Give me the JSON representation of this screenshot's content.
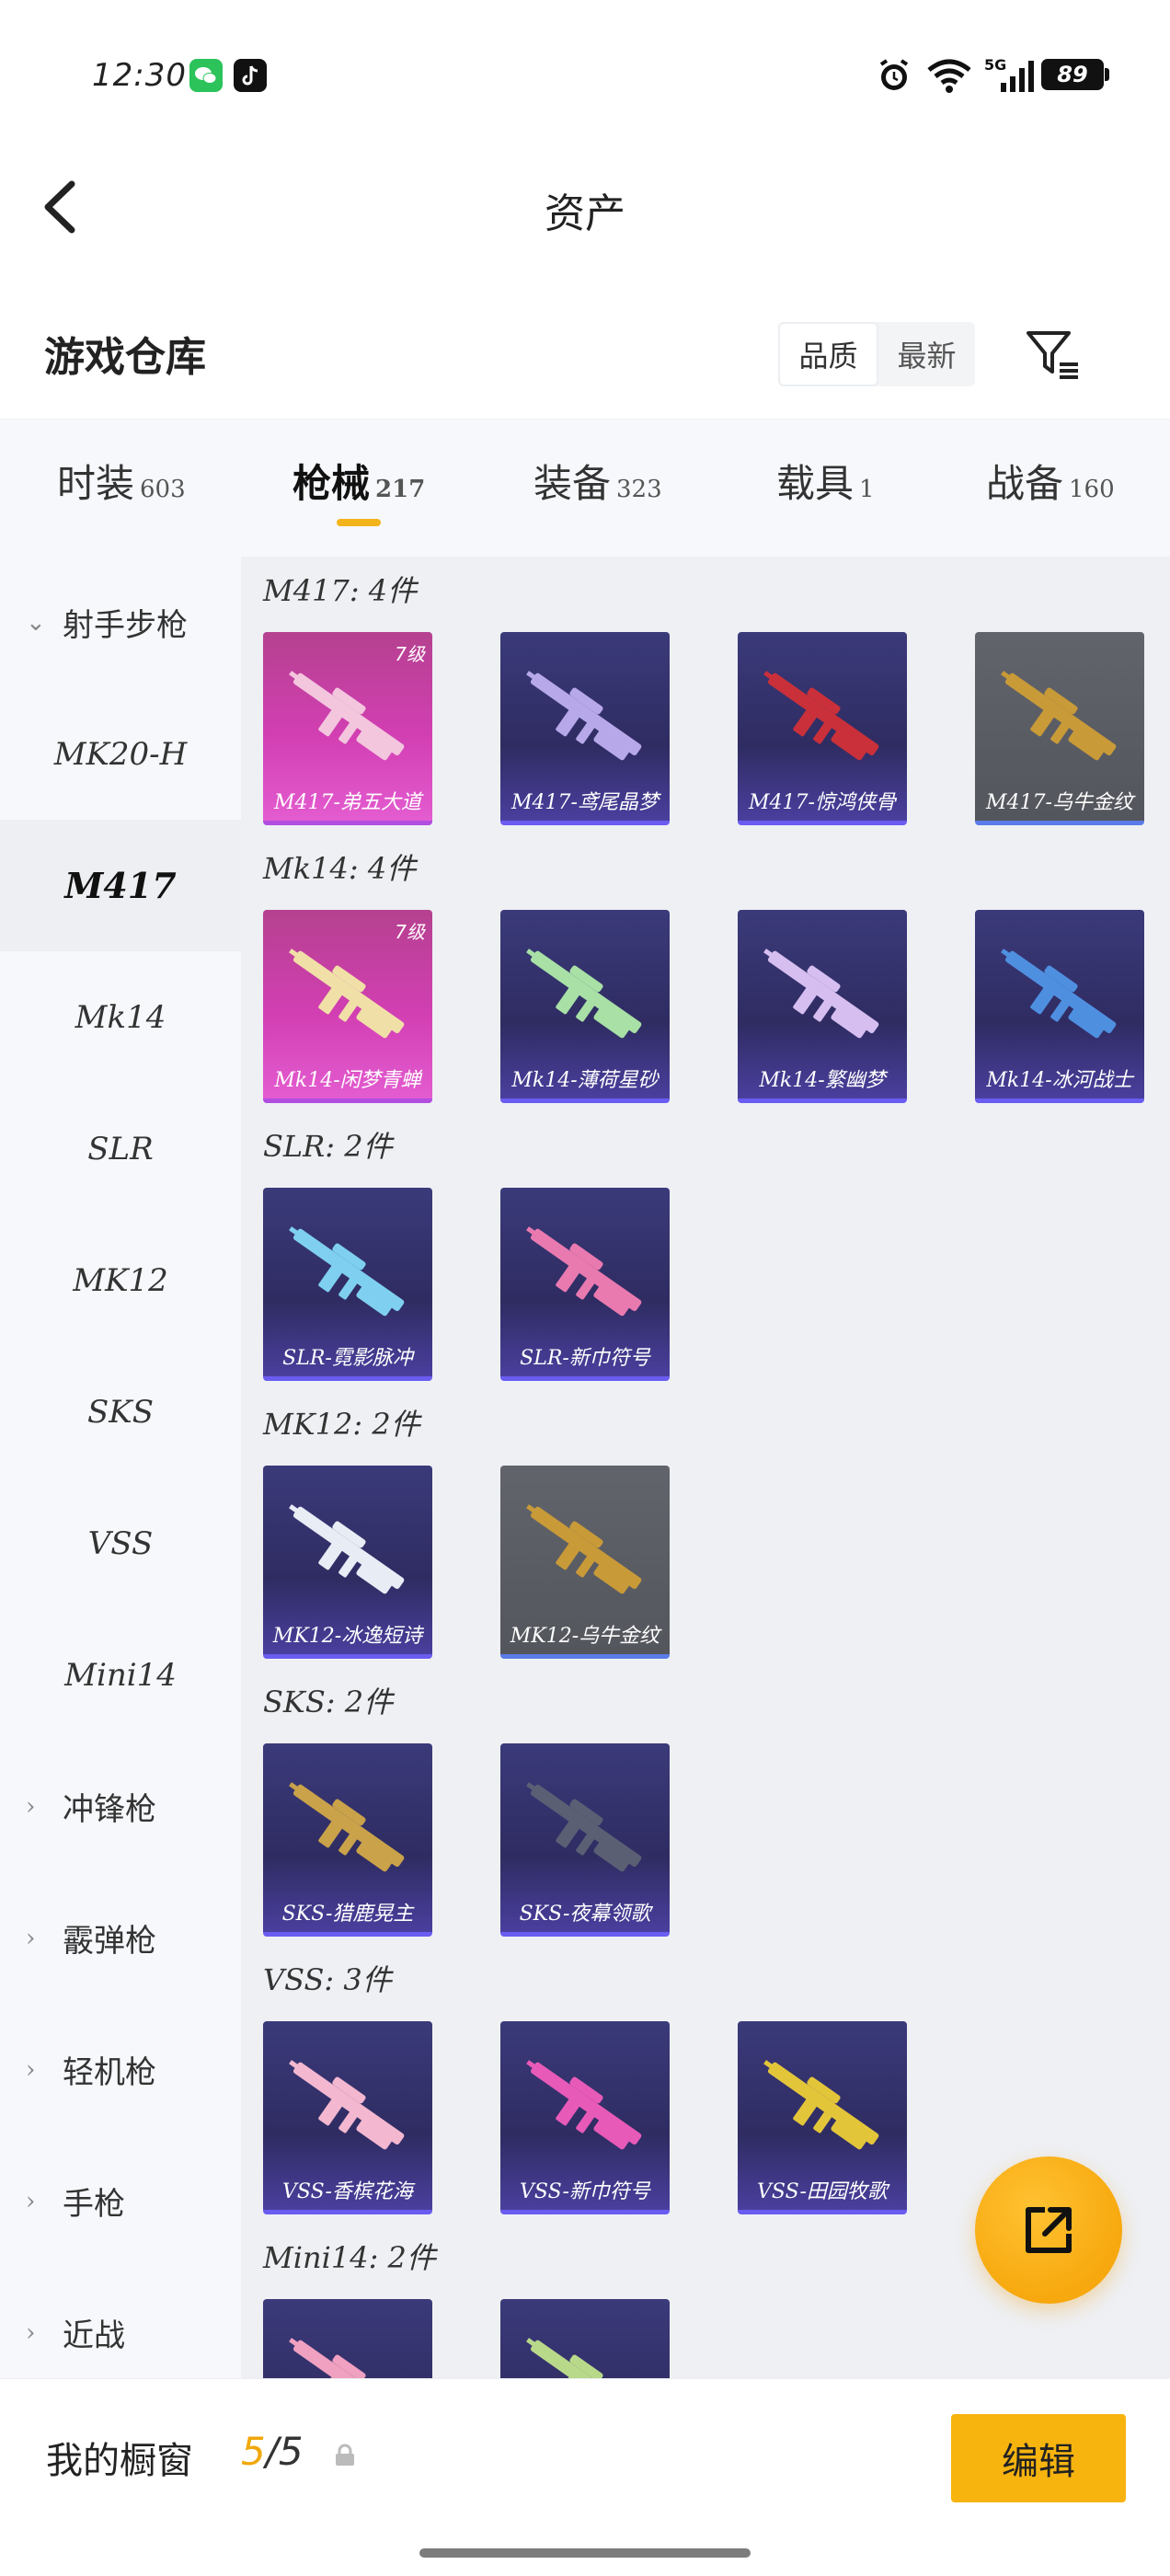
{
  "status_bar": {
    "time": "12:30",
    "battery": "89"
  },
  "header": {
    "title": "资产"
  },
  "warehouse": {
    "title": "游戏仓库",
    "sort_options": [
      "品质",
      "最新"
    ]
  },
  "tabs": [
    {
      "label": "时装",
      "count": "603"
    },
    {
      "label": "枪械",
      "count": "217"
    },
    {
      "label": "装备",
      "count": "323"
    },
    {
      "label": "载具",
      "count": "1"
    },
    {
      "label": "战备",
      "count": "160"
    }
  ],
  "sidebar": {
    "items": [
      {
        "label": "射手步枪",
        "type": "group-open"
      },
      {
        "label": "MK20-H"
      },
      {
        "label": "M417",
        "selected": true
      },
      {
        "label": "Mk14"
      },
      {
        "label": "SLR"
      },
      {
        "label": "MK12"
      },
      {
        "label": "SKS"
      },
      {
        "label": "VSS"
      },
      {
        "label": "Mini14"
      },
      {
        "label": "冲锋枪",
        "type": "group"
      },
      {
        "label": "霰弹枪",
        "type": "group"
      },
      {
        "label": "轻机枪",
        "type": "group"
      },
      {
        "label": "手枪",
        "type": "group"
      },
      {
        "label": "近战",
        "type": "group"
      }
    ]
  },
  "sections": [
    {
      "label": "M417: 4件",
      "items": [
        {
          "name": "M417-弟五大道",
          "level": "7级",
          "style": "pink",
          "gun": "#f3c6de"
        },
        {
          "name": "M417-鸢尾晶梦",
          "style": "purple",
          "gun": "#b7a8ea"
        },
        {
          "name": "M417-惊鸿侠骨",
          "style": "purple",
          "gun": "#c9303a"
        },
        {
          "name": "M417-乌牛金纹",
          "style": "gray",
          "gun": "#c89a38"
        }
      ]
    },
    {
      "label": "Mk14: 4件",
      "items": [
        {
          "name": "Mk14-闲梦青蝉",
          "level": "7级",
          "style": "pink",
          "gun": "#f1dfa8"
        },
        {
          "name": "Mk14-薄荷星砂",
          "style": "purple",
          "gun": "#a8e0a6"
        },
        {
          "name": "Mk14-繁幽梦",
          "style": "purple",
          "gun": "#d6bff0"
        },
        {
          "name": "Mk14-冰河战士",
          "style": "purple",
          "gun": "#4f8fe0"
        }
      ]
    },
    {
      "label": "SLR: 2件",
      "items": [
        {
          "name": "SLR-霓影脉冲",
          "style": "purple",
          "gun": "#7fd0f0"
        },
        {
          "name": "SLR-新巾符号",
          "style": "purple",
          "gun": "#e97ab0"
        }
      ]
    },
    {
      "label": "MK12: 2件",
      "items": [
        {
          "name": "MK12-冰逸短诗",
          "style": "purple",
          "gun": "#e8ecf5"
        },
        {
          "name": "MK12-乌牛金纹",
          "style": "gray",
          "gun": "#c89a38"
        }
      ]
    },
    {
      "label": "SKS: 2件",
      "items": [
        {
          "name": "SKS-猎鹿晃主",
          "style": "purple",
          "gun": "#c9a24a"
        },
        {
          "name": "SKS-夜幕领歌",
          "style": "purple",
          "gun": "#5a5f74"
        }
      ]
    },
    {
      "label": "VSS: 3件",
      "items": [
        {
          "name": "VSS-香槟花海",
          "style": "purple",
          "gun": "#f3b7d0"
        },
        {
          "name": "VSS-新巾符号",
          "style": "purple",
          "gun": "#e85ab8"
        },
        {
          "name": "VSS-田园牧歌",
          "style": "purple",
          "gun": "#e3c53a"
        }
      ]
    },
    {
      "label": "Mini14: 2件",
      "items": [
        {
          "name": "",
          "style": "purple",
          "gun": "#f0a0c0"
        },
        {
          "name": "",
          "style": "purple",
          "gun": "#b9d98a"
        }
      ]
    }
  ],
  "bottom": {
    "showcase_label": "我的橱窗",
    "showcase_current": "5",
    "showcase_total": "/5",
    "edit_label": "编辑"
  }
}
